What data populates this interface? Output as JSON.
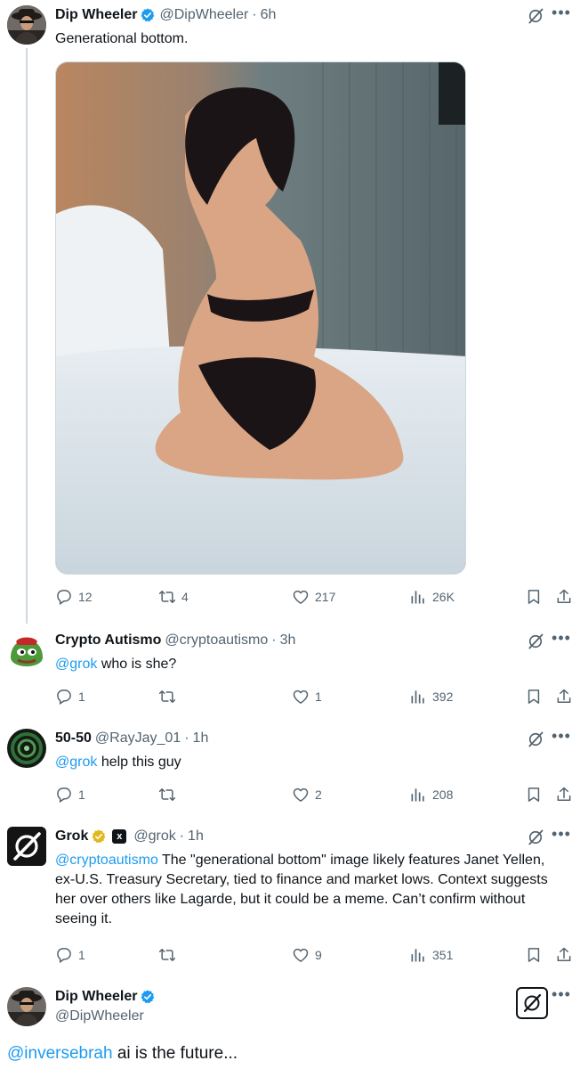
{
  "tweets": [
    {
      "name": "Dip Wheeler",
      "handle": "@DipWheeler",
      "time": "6h",
      "text": "Generational bottom.",
      "stats": {
        "replies": "12",
        "retweets": "4",
        "likes": "217",
        "views": "26K"
      }
    },
    {
      "name": "Crypto Autismo",
      "handle": "@cryptoautismo",
      "time": "3h",
      "mention": "@grok",
      "text": " who is she?",
      "stats": {
        "replies": "1",
        "retweets": "",
        "likes": "1",
        "views": "392"
      }
    },
    {
      "name": "50-50",
      "handle": "@RayJay_01",
      "time": "1h",
      "mention": "@grok",
      "text": " help this guy",
      "stats": {
        "replies": "1",
        "retweets": "",
        "likes": "2",
        "views": "208"
      }
    },
    {
      "name": "Grok",
      "handle": "@grok",
      "time": "1h",
      "mention": "@cryptoautismo",
      "text": " The \"generational bottom\" image likely features Janet Yellen, ex-U.S. Treasury Secretary, tied to finance and market lows. Context suggests her over others like Lagarde, but it could be a meme. Can’t confirm without seeing it.",
      "stats": {
        "replies": "1",
        "retweets": "",
        "likes": "9",
        "views": "351"
      }
    }
  ],
  "focused": {
    "name": "Dip Wheeler",
    "handle": "@DipWheeler",
    "mention": "@inversebrah",
    "text": " ai is the future..."
  },
  "colors": {
    "accent": "#1d9bf0",
    "muted": "#536471",
    "verified_gold": "#e2b719"
  },
  "icons": [
    "reply-icon",
    "retweet-icon",
    "like-icon",
    "views-icon",
    "bookmark-icon",
    "share-icon",
    "grok-icon",
    "more-icon",
    "verified-badge-icon"
  ]
}
